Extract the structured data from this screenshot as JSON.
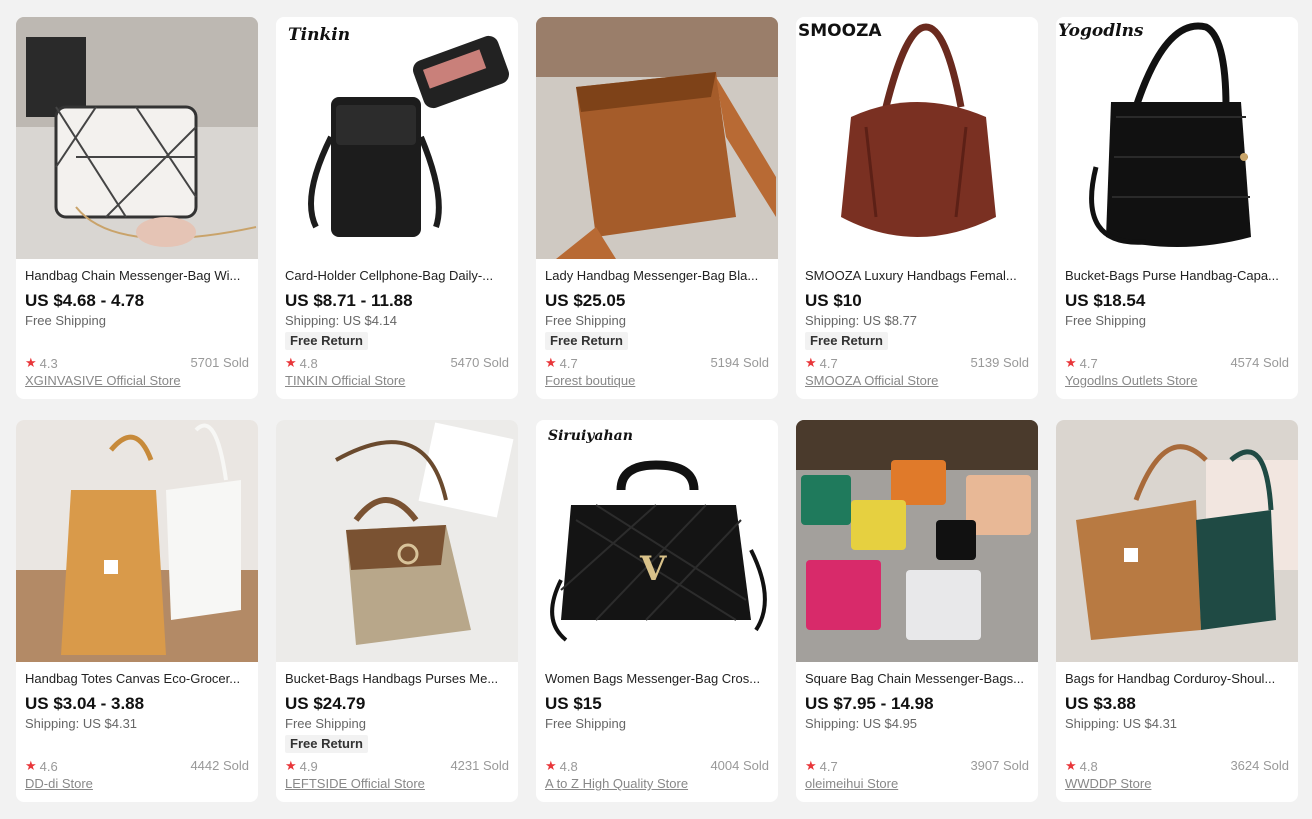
{
  "products": [
    {
      "title": "Handbag Chain Messenger-Bag Wi...",
      "price": "US $4.68 - 4.78",
      "shipping": "Free Shipping",
      "badge": "",
      "rating": "4.3",
      "sold": "5701 Sold",
      "store": "XGINVASIVE Official Store",
      "brand_mark": ""
    },
    {
      "title": "Card-Holder Cellphone-Bag Daily-...",
      "price": "US $8.71 - 11.88",
      "shipping": "Shipping: US $4.14",
      "badge": "Free Return",
      "rating": "4.8",
      "sold": "5470 Sold",
      "store": "TINKIN Official Store",
      "brand_mark": "Tinkin"
    },
    {
      "title": "Lady Handbag Messenger-Bag Bla...",
      "price": "US $25.05",
      "shipping": "Free Shipping",
      "badge": "Free Return",
      "rating": "4.7",
      "sold": "5194 Sold",
      "store": "Forest boutique",
      "brand_mark": ""
    },
    {
      "title": "SMOOZA Luxury Handbags Femal...",
      "price": "US $10",
      "shipping": "Shipping: US $8.77",
      "badge": "Free Return",
      "rating": "4.7",
      "sold": "5139 Sold",
      "store": "SMOOZA Official Store",
      "brand_mark": "SMOOZA"
    },
    {
      "title": "Bucket-Bags Purse Handbag-Capa...",
      "price": "US $18.54",
      "shipping": "Free Shipping",
      "badge": "",
      "rating": "4.7",
      "sold": "4574 Sold",
      "store": "Yogodlns Outlets Store",
      "brand_mark": "Yogodlns"
    },
    {
      "title": "Handbag Totes Canvas Eco-Grocer...",
      "price": "US $3.04 - 3.88",
      "shipping": "Shipping: US $4.31",
      "badge": "",
      "rating": "4.6",
      "sold": "4442 Sold",
      "store": "DD-di Store",
      "brand_mark": ""
    },
    {
      "title": "Bucket-Bags Handbags Purses Me...",
      "price": "US $24.79",
      "shipping": "Free Shipping",
      "badge": "Free Return",
      "rating": "4.9",
      "sold": "4231 Sold",
      "store": "LEFTSIDE Official Store",
      "brand_mark": ""
    },
    {
      "title": "Women Bags Messenger-Bag Cros...",
      "price": "US $15",
      "shipping": "Free Shipping",
      "badge": "",
      "rating": "4.8",
      "sold": "4004 Sold",
      "store": "A to Z High Quality Store",
      "brand_mark": "Siruiyahan"
    },
    {
      "title": "Square Bag Chain Messenger-Bags...",
      "price": "US $7.95 - 14.98",
      "shipping": "Shipping: US $4.95",
      "badge": "",
      "rating": "4.7",
      "sold": "3907 Sold",
      "store": "oleimeihui Store",
      "brand_mark": ""
    },
    {
      "title": "Bags for Handbag Corduroy-Shoul...",
      "price": "US $3.88",
      "shipping": "Shipping: US $4.31",
      "badge": "",
      "rating": "4.8",
      "sold": "3624 Sold",
      "store": "WWDDP Store",
      "brand_mark": ""
    }
  ],
  "colors": {
    "star": "#e8363a",
    "background": "#f2f2f2",
    "card": "#ffffff"
  }
}
